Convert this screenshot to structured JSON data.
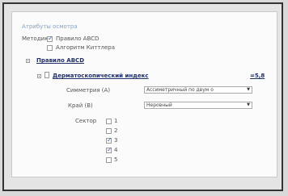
{
  "group_title": "Атрибуты осмотра",
  "method": {
    "label": "Методика",
    "options": [
      {
        "label": "Правило ABCD",
        "checked": true
      },
      {
        "label": "Алгоритм Киттлера",
        "checked": false
      }
    ]
  },
  "rule_node": {
    "label": "Правило ABCD"
  },
  "index_node": {
    "label": "Дерматоскопический индекс",
    "value": "=5,8"
  },
  "symmetry": {
    "label": "Симметрия (A)",
    "selected": "Ассиметричный по двум о"
  },
  "edge": {
    "label": "Край (B)",
    "selected": "Неровный"
  },
  "sector": {
    "label": "Сектор",
    "items": [
      {
        "num": "1",
        "checked": false
      },
      {
        "num": "2",
        "checked": false
      },
      {
        "num": "3",
        "checked": true
      },
      {
        "num": "4",
        "checked": true
      },
      {
        "num": "5",
        "checked": false
      }
    ]
  },
  "icons": {
    "checkmark": "check-icon",
    "dropdown": "chevron-down-icon",
    "tree": "tree-expander-icon",
    "node": "document-icon"
  }
}
